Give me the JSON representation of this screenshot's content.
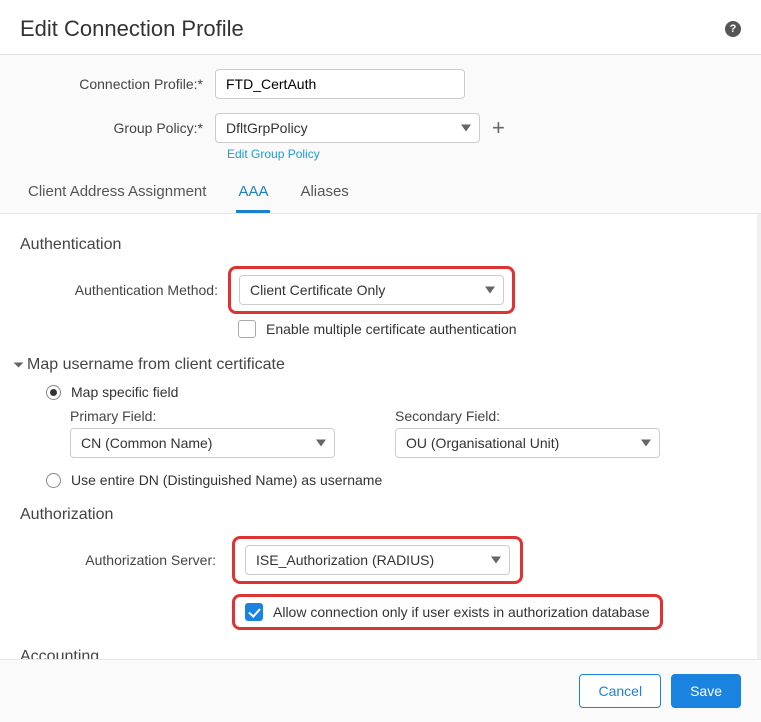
{
  "title": "Edit Connection Profile",
  "fields": {
    "connection_profile_label": "Connection Profile:*",
    "connection_profile_value": "FTD_CertAuth",
    "group_policy_label": "Group Policy:*",
    "group_policy_value": "DfltGrpPolicy",
    "edit_group_link": "Edit Group Policy"
  },
  "tabs": {
    "t1": "Client Address Assignment",
    "t2": "AAA",
    "t3": "Aliases"
  },
  "auth": {
    "section": "Authentication",
    "method_label": "Authentication Method:",
    "method_value": "Client Certificate Only",
    "enable_multi_label": "Enable multiple certificate authentication"
  },
  "map": {
    "title": "Map username from client certificate",
    "opt_specific": "Map specific field",
    "primary_label": "Primary Field:",
    "primary_value": "CN (Common Name)",
    "secondary_label": "Secondary Field:",
    "secondary_value": "OU (Organisational Unit)",
    "opt_dn": "Use entire DN (Distinguished Name) as username"
  },
  "authz": {
    "section": "Authorization",
    "server_label": "Authorization Server:",
    "server_value": "ISE_Authorization (RADIUS)",
    "allow_label": "Allow connection only if user exists in authorization database"
  },
  "acct": {
    "section": "Accounting"
  },
  "footer": {
    "cancel": "Cancel",
    "save": "Save"
  }
}
